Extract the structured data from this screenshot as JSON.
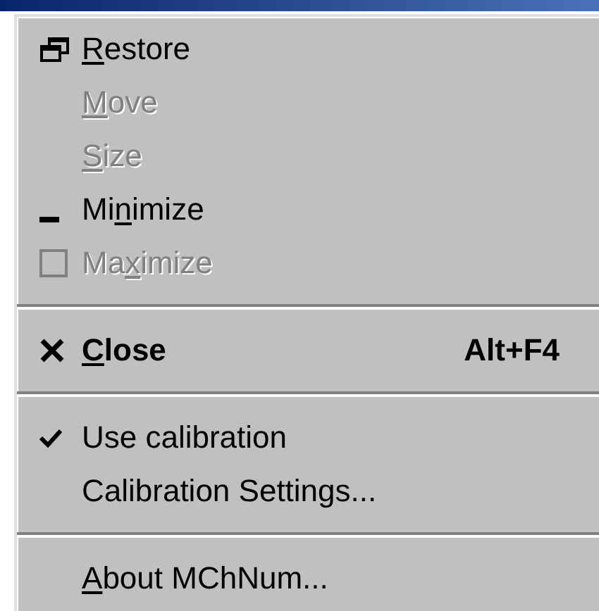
{
  "menu": {
    "items": [
      {
        "kind": "item",
        "key": "R",
        "post": "estore",
        "disabled": false,
        "bold": false,
        "checked": false
      },
      {
        "kind": "item",
        "key": "M",
        "post": "ove",
        "disabled": true,
        "bold": false,
        "checked": false
      },
      {
        "kind": "item",
        "key": "S",
        "post": "ize",
        "disabled": true,
        "bold": false,
        "checked": false
      },
      {
        "kind": "item",
        "pre": "Mi",
        "key": "n",
        "post": "imize",
        "disabled": false,
        "bold": false,
        "checked": false
      },
      {
        "kind": "item",
        "pre": "Ma",
        "key": "x",
        "post": "imize",
        "disabled": true,
        "bold": false,
        "checked": false
      },
      {
        "kind": "separator"
      },
      {
        "kind": "item",
        "key": "C",
        "post": "lose",
        "shortcut": "Alt+F4",
        "disabled": false,
        "bold": true,
        "checked": false
      },
      {
        "kind": "separator"
      },
      {
        "kind": "item",
        "pre": "Use calibration",
        "disabled": false,
        "bold": false,
        "checked": true
      },
      {
        "kind": "item",
        "pre": "Calibration Settings...",
        "disabled": false,
        "bold": false,
        "checked": false
      },
      {
        "kind": "separator"
      },
      {
        "kind": "item",
        "key": "A",
        "post": "bout MChNum...",
        "disabled": false,
        "bold": false,
        "checked": false
      }
    ]
  }
}
